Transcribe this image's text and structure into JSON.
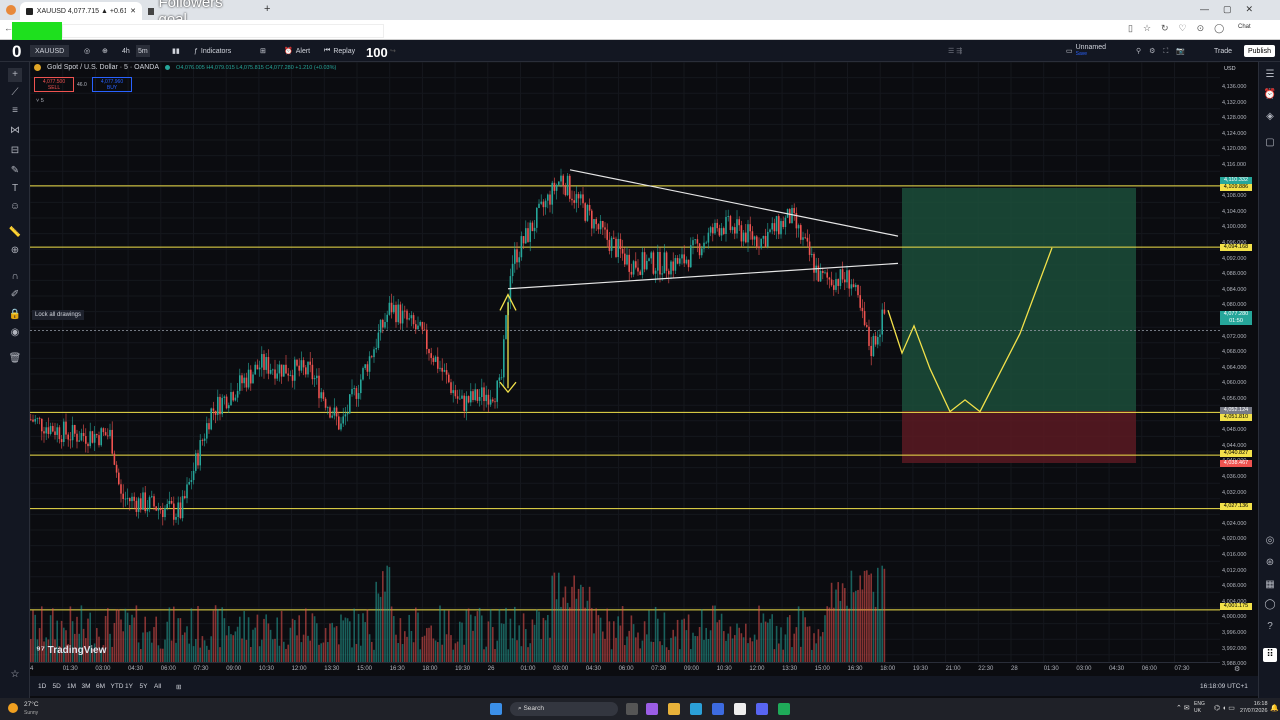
{
  "browser": {
    "tab1_title": "XAUUSD 4,077.715 ▲ +0.61% Un",
    "tab2_title": "Followers goal",
    "new_tab": "+"
  },
  "overlay": {
    "counter_left": "0",
    "counter_right": "100"
  },
  "toolbar": {
    "symbol": "XAUUSD",
    "interval_4h": "4h",
    "interval_5m": "5m",
    "indicators": "Indicators",
    "alert": "Alert",
    "replay": "Replay",
    "layout_name": "Unnamed",
    "layout_sub": "Save",
    "trade": "Trade",
    "publish": "Publish"
  },
  "legend": {
    "title": "Gold Spot / U.S. Dollar · 5 · OANDA",
    "ohlc": "O4,076.005 H4,079.015 L4,075.815 C4,077.280 +1.210 (+0.03%)",
    "sell_price": "4,077.500",
    "sell_label": "SELL",
    "spread": "46.0",
    "buy_price": "4,077.960",
    "buy_label": "BUY",
    "indicator_count": "5"
  },
  "lock_tooltip": "Lock all drawings",
  "yaxis": {
    "currency": "USD",
    "labels": [
      "4,136.000",
      "4,132.000",
      "4,128.000",
      "4,124.000",
      "4,120.000",
      "4,116.000",
      "4,112.000",
      "4,108.000",
      "4,104.000",
      "4,100.000",
      "4,096.000",
      "4,092.000",
      "4,088.000",
      "4,084.000",
      "4,080.000",
      "4,076.000",
      "4,072.000",
      "4,068.000",
      "4,064.000",
      "4,060.000",
      "4,056.000",
      "4,052.000",
      "4,048.000",
      "4,044.000",
      "4,040.000",
      "4,036.000",
      "4,032.000",
      "4,028.000",
      "4,024.000",
      "4,020.000",
      "4,016.000",
      "4,012.000",
      "4,008.000",
      "4,004.000",
      "4,000.000",
      "3,996.000",
      "3,992.000",
      "3,988.000"
    ],
    "tags": [
      {
        "text": "4,110.332",
        "color": "#26a69a"
      },
      {
        "text": "4,109.886",
        "color": "#f2e14a"
      },
      {
        "text": "4,094.168",
        "color": "#f2e14a"
      },
      {
        "text": "4,077.280",
        "color": "#26a69a"
      },
      {
        "text": "01:50",
        "color": "#26a69a"
      },
      {
        "text": "4,052.124",
        "color": "#787b86"
      },
      {
        "text": "4,051.810",
        "color": "#f2e14a"
      },
      {
        "text": "4,040.827",
        "color": "#f2e14a"
      },
      {
        "text": "4,038.467",
        "color": "#ef5350"
      },
      {
        "text": "4,027.136",
        "color": "#f2e14a"
      },
      {
        "text": "4,001.175",
        "color": "#f2e14a"
      }
    ]
  },
  "xaxis": {
    "labels": [
      "4",
      "01:30",
      "03:00",
      "04:30",
      "06:00",
      "07:30",
      "09:00",
      "10:30",
      "12:00",
      "13:30",
      "15:00",
      "16:30",
      "18:00",
      "19:30",
      "26",
      "01:00",
      "03:00",
      "04:30",
      "06:00",
      "07:30",
      "09:00",
      "10:30",
      "12:00",
      "13:30",
      "15:00",
      "16:30",
      "18:00",
      "19:30",
      "21:00",
      "22:30",
      "28",
      "01:30",
      "03:00",
      "04:30",
      "06:00",
      "07:30"
    ]
  },
  "bottom": {
    "ranges": [
      "1D",
      "5D",
      "1M",
      "3M",
      "6M",
      "YTD",
      "1Y",
      "5Y",
      "All"
    ],
    "clock": "16:18:09 UTC+1"
  },
  "watermark": "TradingView",
  "taskbar": {
    "weather_temp": "27°C",
    "weather_desc": "Sunny",
    "search": "Search",
    "lang": "ENG",
    "region": "UK",
    "time": "16:18",
    "date": "27/07/2026"
  },
  "colors": {
    "level_line": "#f2e14a",
    "target_zone": "#1b4d3a",
    "stop_zone": "#5a1a22",
    "bull": "#26a69a",
    "bear": "#ef5350"
  }
}
